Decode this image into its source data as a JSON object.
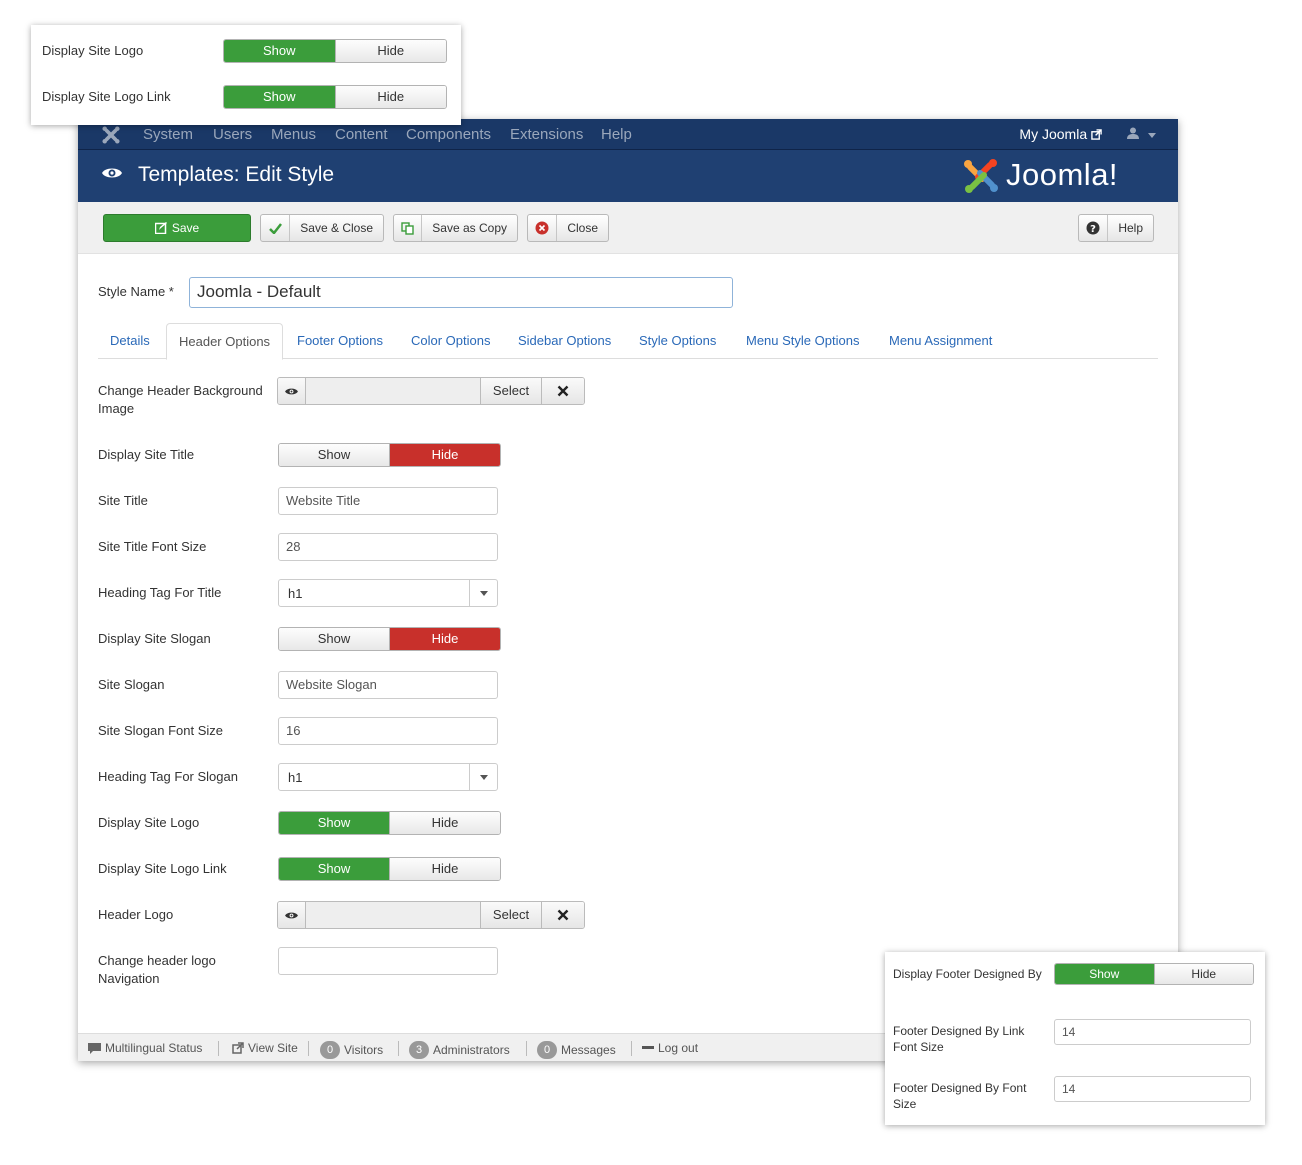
{
  "topnav": {
    "items": [
      "System",
      "Users",
      "Menus",
      "Content",
      "Components",
      "Extensions",
      "Help"
    ],
    "site_link": "My Joomla"
  },
  "titlebar": {
    "title": "Templates: Edit Style",
    "brand": "Joomla!"
  },
  "toolbar": {
    "save": "Save",
    "save_close": "Save & Close",
    "save_copy": "Save as Copy",
    "close": "Close",
    "help": "Help"
  },
  "style_name": {
    "label": "Style Name *",
    "value": "Joomla - Default"
  },
  "tabs": [
    "Details",
    "Header Options",
    "Footer Options",
    "Color Options",
    "Sidebar Options",
    "Style Options",
    "Menu Style Options",
    "Menu Assignment"
  ],
  "active_tab": "Header Options",
  "toggle": {
    "show": "Show",
    "hide": "Hide"
  },
  "media_select": "Select",
  "fields": {
    "header_bg_image": {
      "label": "Change Header Background Image"
    },
    "display_site_title": {
      "label": "Display Site Title",
      "value": "Hide"
    },
    "site_title": {
      "label": "Site Title",
      "value": "Website Title"
    },
    "site_title_font_size": {
      "label": "Site Title Font Size",
      "value": "28"
    },
    "heading_tag_title": {
      "label": "Heading Tag For Title",
      "value": "h1"
    },
    "display_site_slogan": {
      "label": "Display Site Slogan",
      "value": "Hide"
    },
    "site_slogan": {
      "label": "Site Slogan",
      "value": "Website Slogan"
    },
    "site_slogan_font_size": {
      "label": "Site Slogan Font Size",
      "value": "16"
    },
    "heading_tag_slogan": {
      "label": "Heading Tag For Slogan",
      "value": "h1"
    },
    "display_site_logo": {
      "label": "Display Site Logo",
      "value": "Show"
    },
    "display_site_logo_link": {
      "label": "Display Site Logo Link",
      "value": "Show"
    },
    "header_logo": {
      "label": "Header Logo"
    },
    "header_logo_nav": {
      "label": "Change header logo Navigation",
      "value": ""
    }
  },
  "statusbar": {
    "multilingual": "Multilingual Status",
    "view_site": "View Site",
    "visitors_count": "0",
    "visitors": "Visitors",
    "admins_count": "3",
    "admins": "Administrators",
    "messages_count": "0",
    "messages": "Messages",
    "logout": "Log out"
  },
  "callout_top": {
    "row1_label": "Display Site Logo",
    "row2_label": "Display Site Logo Link"
  },
  "callout_footer": {
    "row1_label": "Display Footer Designed By",
    "row2_label": "Footer Designed By Link Font Size",
    "row2_value": "14",
    "row3_label": "Footer Designed By Font Size",
    "row3_value": "14"
  },
  "colors": {
    "navbar": "#1a3867",
    "titlebar": "#1f4072",
    "success": "#3b9d3b",
    "danger": "#c8302b",
    "link": "#2a69b8"
  }
}
